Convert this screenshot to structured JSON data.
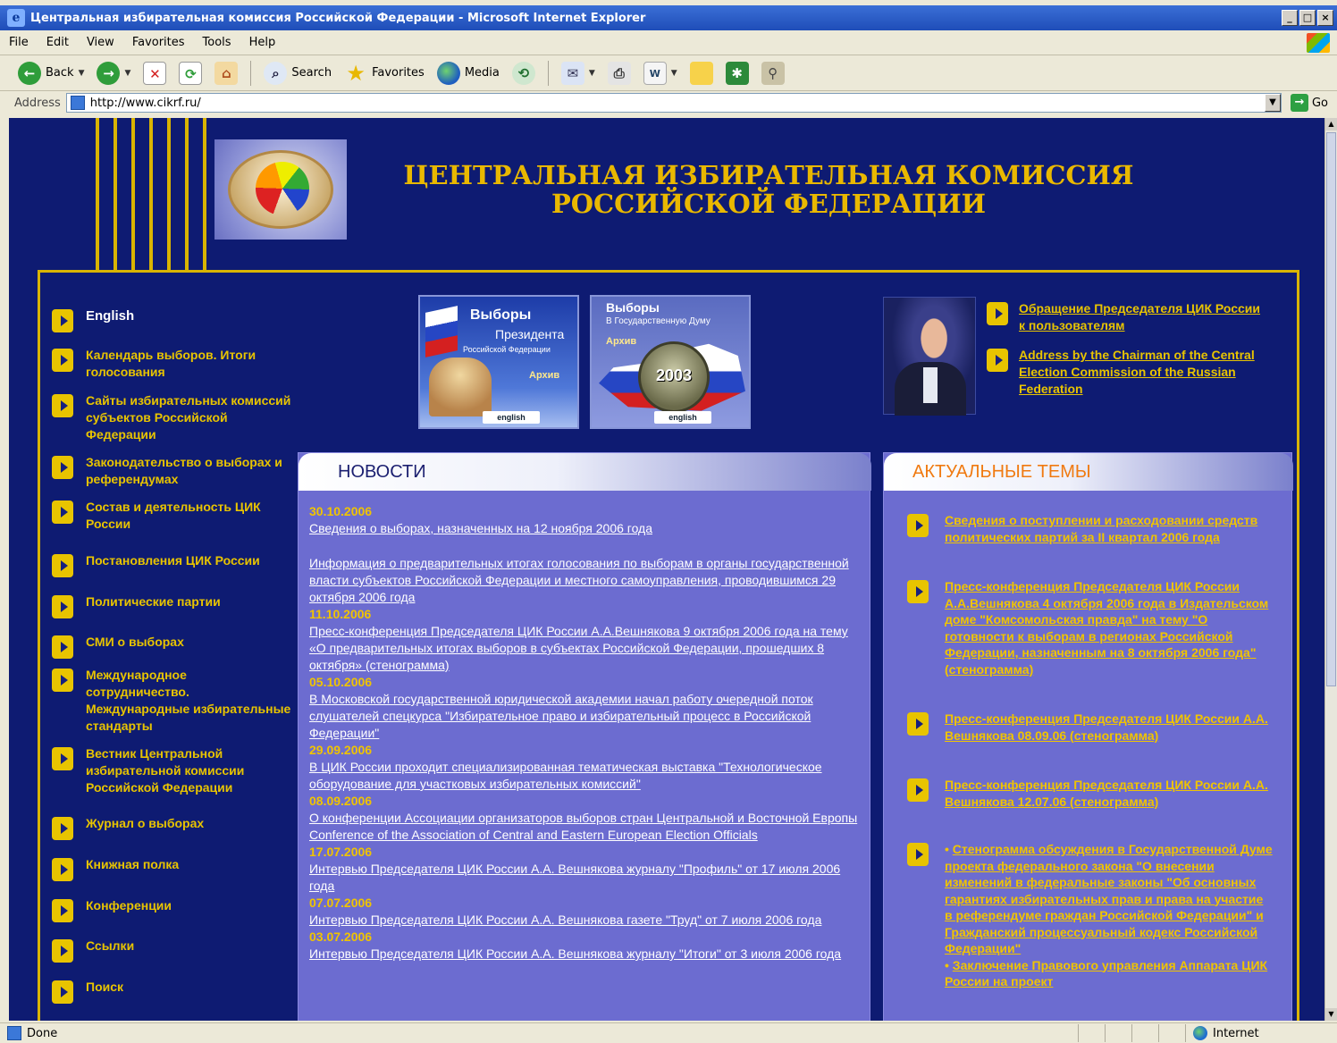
{
  "window": {
    "title": "Центральная избирательная комиссия Российской Федерации - Microsoft Internet Explorer"
  },
  "menu": [
    "File",
    "Edit",
    "View",
    "Favorites",
    "Tools",
    "Help"
  ],
  "toolbar": {
    "back": "Back",
    "search": "Search",
    "favorites": "Favorites",
    "media": "Media"
  },
  "address": {
    "label": "Address",
    "url": "http://www.cikrf.ru/",
    "go": "Go"
  },
  "header": {
    "title_line1": "ЦЕНТРАЛЬНАЯ ИЗБИРАТЕЛЬНАЯ КОМИССИЯ",
    "title_line2": "РОССИЙСКОЙ ФЕДЕРАЦИИ"
  },
  "nav": [
    "English",
    "Календарь выборов. Итоги голосования",
    "Сайты избирательных комиссий субъектов Российской Федерации",
    "Законодательство о выборах и референдумах",
    "Состав и деятельность ЦИК России",
    "Постановления ЦИК России",
    "Политические партии",
    "СМИ о выборах",
    "Международное сотрудничество. Международные избирательные стандарты",
    "Вестник Центральной избирательной комиссии Российской Федерации",
    "Журнал о выборах",
    "Книжная полка",
    "Конференции",
    "Ссылки",
    "Поиск"
  ],
  "banners": {
    "president": {
      "title": "Выборы",
      "subtitle": "Президента",
      "small": "Российской Федерации",
      "archive": "Архив",
      "english": "english"
    },
    "duma": {
      "title": "Выборы",
      "subtitle": "В Государственную Думу",
      "archive": "Архив",
      "year": "2003",
      "english": "english"
    }
  },
  "chairman": {
    "links": [
      "Обращение Председателя ЦИК России к пользователям",
      "Address by the Chairman of the Central Election Commission of the Russian Federation"
    ]
  },
  "news": {
    "heading": "НОВОСТИ",
    "items": [
      {
        "date": "30.10.2006",
        "text": "Сведения о выборах, назначенных на 12 ноября 2006 года"
      },
      {
        "date": "",
        "text": "Информация о предварительных итогах голосования по выборам в органы государственной власти субъектов Российской Федерации и местного самоуправления, проводившимся 29 октября 2006 года"
      },
      {
        "date": "11.10.2006",
        "text": "Пресс-конференция Председателя ЦИК России А.А.Вешнякова 9 октября 2006 года на тему «О предварительных итогах выборов в субъектах Российской Федерации, прошедших 8 октября» (стенограмма)"
      },
      {
        "date": "05.10.2006",
        "text": "В Московской государственной юридической академии начал работу очередной поток слушателей спецкурса \"Избирательное право и избирательный процесс в Российской Федерации\""
      },
      {
        "date": "29.09.2006",
        "text": "В ЦИК России проходит специализированная тематическая выставка \"Технологическое оборудование для участковых избирательных комиссий\""
      },
      {
        "date": "08.09.2006",
        "text": "О конференции Ассоциации организаторов выборов стран Центральной и Восточной Европы"
      },
      {
        "date": "",
        "text": "Conference of the Association of Central and Eastern European Election Officials"
      },
      {
        "date": "17.07.2006",
        "text": "Интервью Председателя ЦИК России А.А. Вешнякова журналу \"Профиль\" от 17 июля 2006 года"
      },
      {
        "date": "07.07.2006",
        "text": "Интервью Председателя ЦИК России А.А. Вешнякова газете \"Труд\" от 7 июля 2006 года"
      },
      {
        "date": "03.07.2006",
        "text": "Интервью Председателя ЦИК России А.А. Вешнякова журналу \"Итоги\" от 3 июля 2006 года"
      }
    ]
  },
  "topics": {
    "heading": "АКТУАЛЬНЫЕ ТЕМЫ",
    "items": [
      "Сведения о поступлении и расходовании средств политических партий за II квартал 2006 года",
      "Пресс-конференция Председателя ЦИК России А.А.Вешнякова 4 октября 2006 года в Издательском доме \"Комсомольская правда\" на тему \"О готовности к выборам в регионах Российской Федерации, назначенным на 8 октября 2006 года\" (стенограмма)",
      "Пресс-конференция Председателя ЦИК России А.А. Вешнякова 08.09.06 (стенограмма)",
      "Пресс-конференция Председателя ЦИК России А.А. Вешнякова 12.07.06 (стенограмма)"
    ],
    "sub_items": [
      "Стенограмма обсуждения в Государственной Думе проекта федерального закона \"О внесении изменений в федеральные законы \"Об основных гарантиях избирательных прав и права на участие в референдуме граждан Российской Федерации\" и Гражданский процессуальный кодекс Российской Федерации\"",
      "Заключение Правового управления Аппарата ЦИК России на проект"
    ]
  },
  "status": {
    "text": "Done",
    "zone": "Internet"
  }
}
